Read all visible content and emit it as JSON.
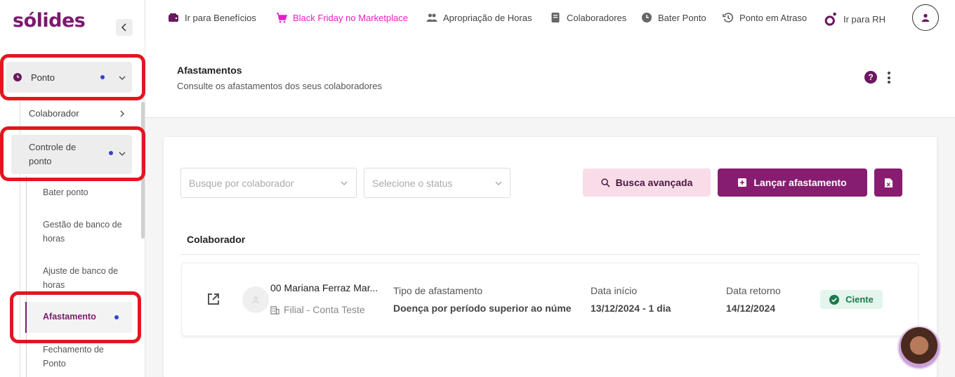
{
  "sidebar": {
    "logo": "sólides",
    "menu": {
      "ponto": "Ponto",
      "colaborador": "Colaborador",
      "controle": "Controle de ponto",
      "bater_ponto": "Bater ponto",
      "gestao_banco": "Gestão de banco de horas",
      "ajuste_banco": "Ajuste de banco de horas",
      "afastamento": "Afastamento",
      "fechamento": "Fechamento de Ponto"
    }
  },
  "topnav": {
    "beneficios": "Ir para Benefícios",
    "black_friday": "Black Friday no Marketplace",
    "apropriacao": "Apropriação de Horas",
    "colaboradores": "Colaboradores",
    "bater_ponto": "Bater Ponto",
    "ponto_atraso": "Ponto em Atraso",
    "ir_rh": "Ir para RH"
  },
  "header": {
    "title": "Afastamentos",
    "subtitle": "Consulte os afastamentos dos seus colaboradores",
    "help": "?"
  },
  "filters": {
    "colaborador_placeholder": "Busque por colaborador",
    "status_placeholder": "Selecione o status"
  },
  "actions": {
    "busca_avancada": "Busca avançada",
    "lancar_afastamento": "Lançar afastamento"
  },
  "table": {
    "column": "Colaborador",
    "rows": [
      {
        "name": "00 Mariana Ferraz Mar...",
        "branch": "Filial - Conta Teste",
        "tipo_label": "Tipo de afastamento",
        "tipo_value": "Doença por período superior ao núme",
        "inicio_label": "Data início",
        "inicio_value": "13/12/2024 - 1 dia",
        "retorno_label": "Data retorno",
        "retorno_value": "14/12/2024",
        "status": "Ciente"
      }
    ]
  },
  "colors": {
    "brand": "#861d71",
    "black_friday": "#e81fc8",
    "status_ok": "#1c7a4c",
    "highlight": "#e3161f"
  }
}
